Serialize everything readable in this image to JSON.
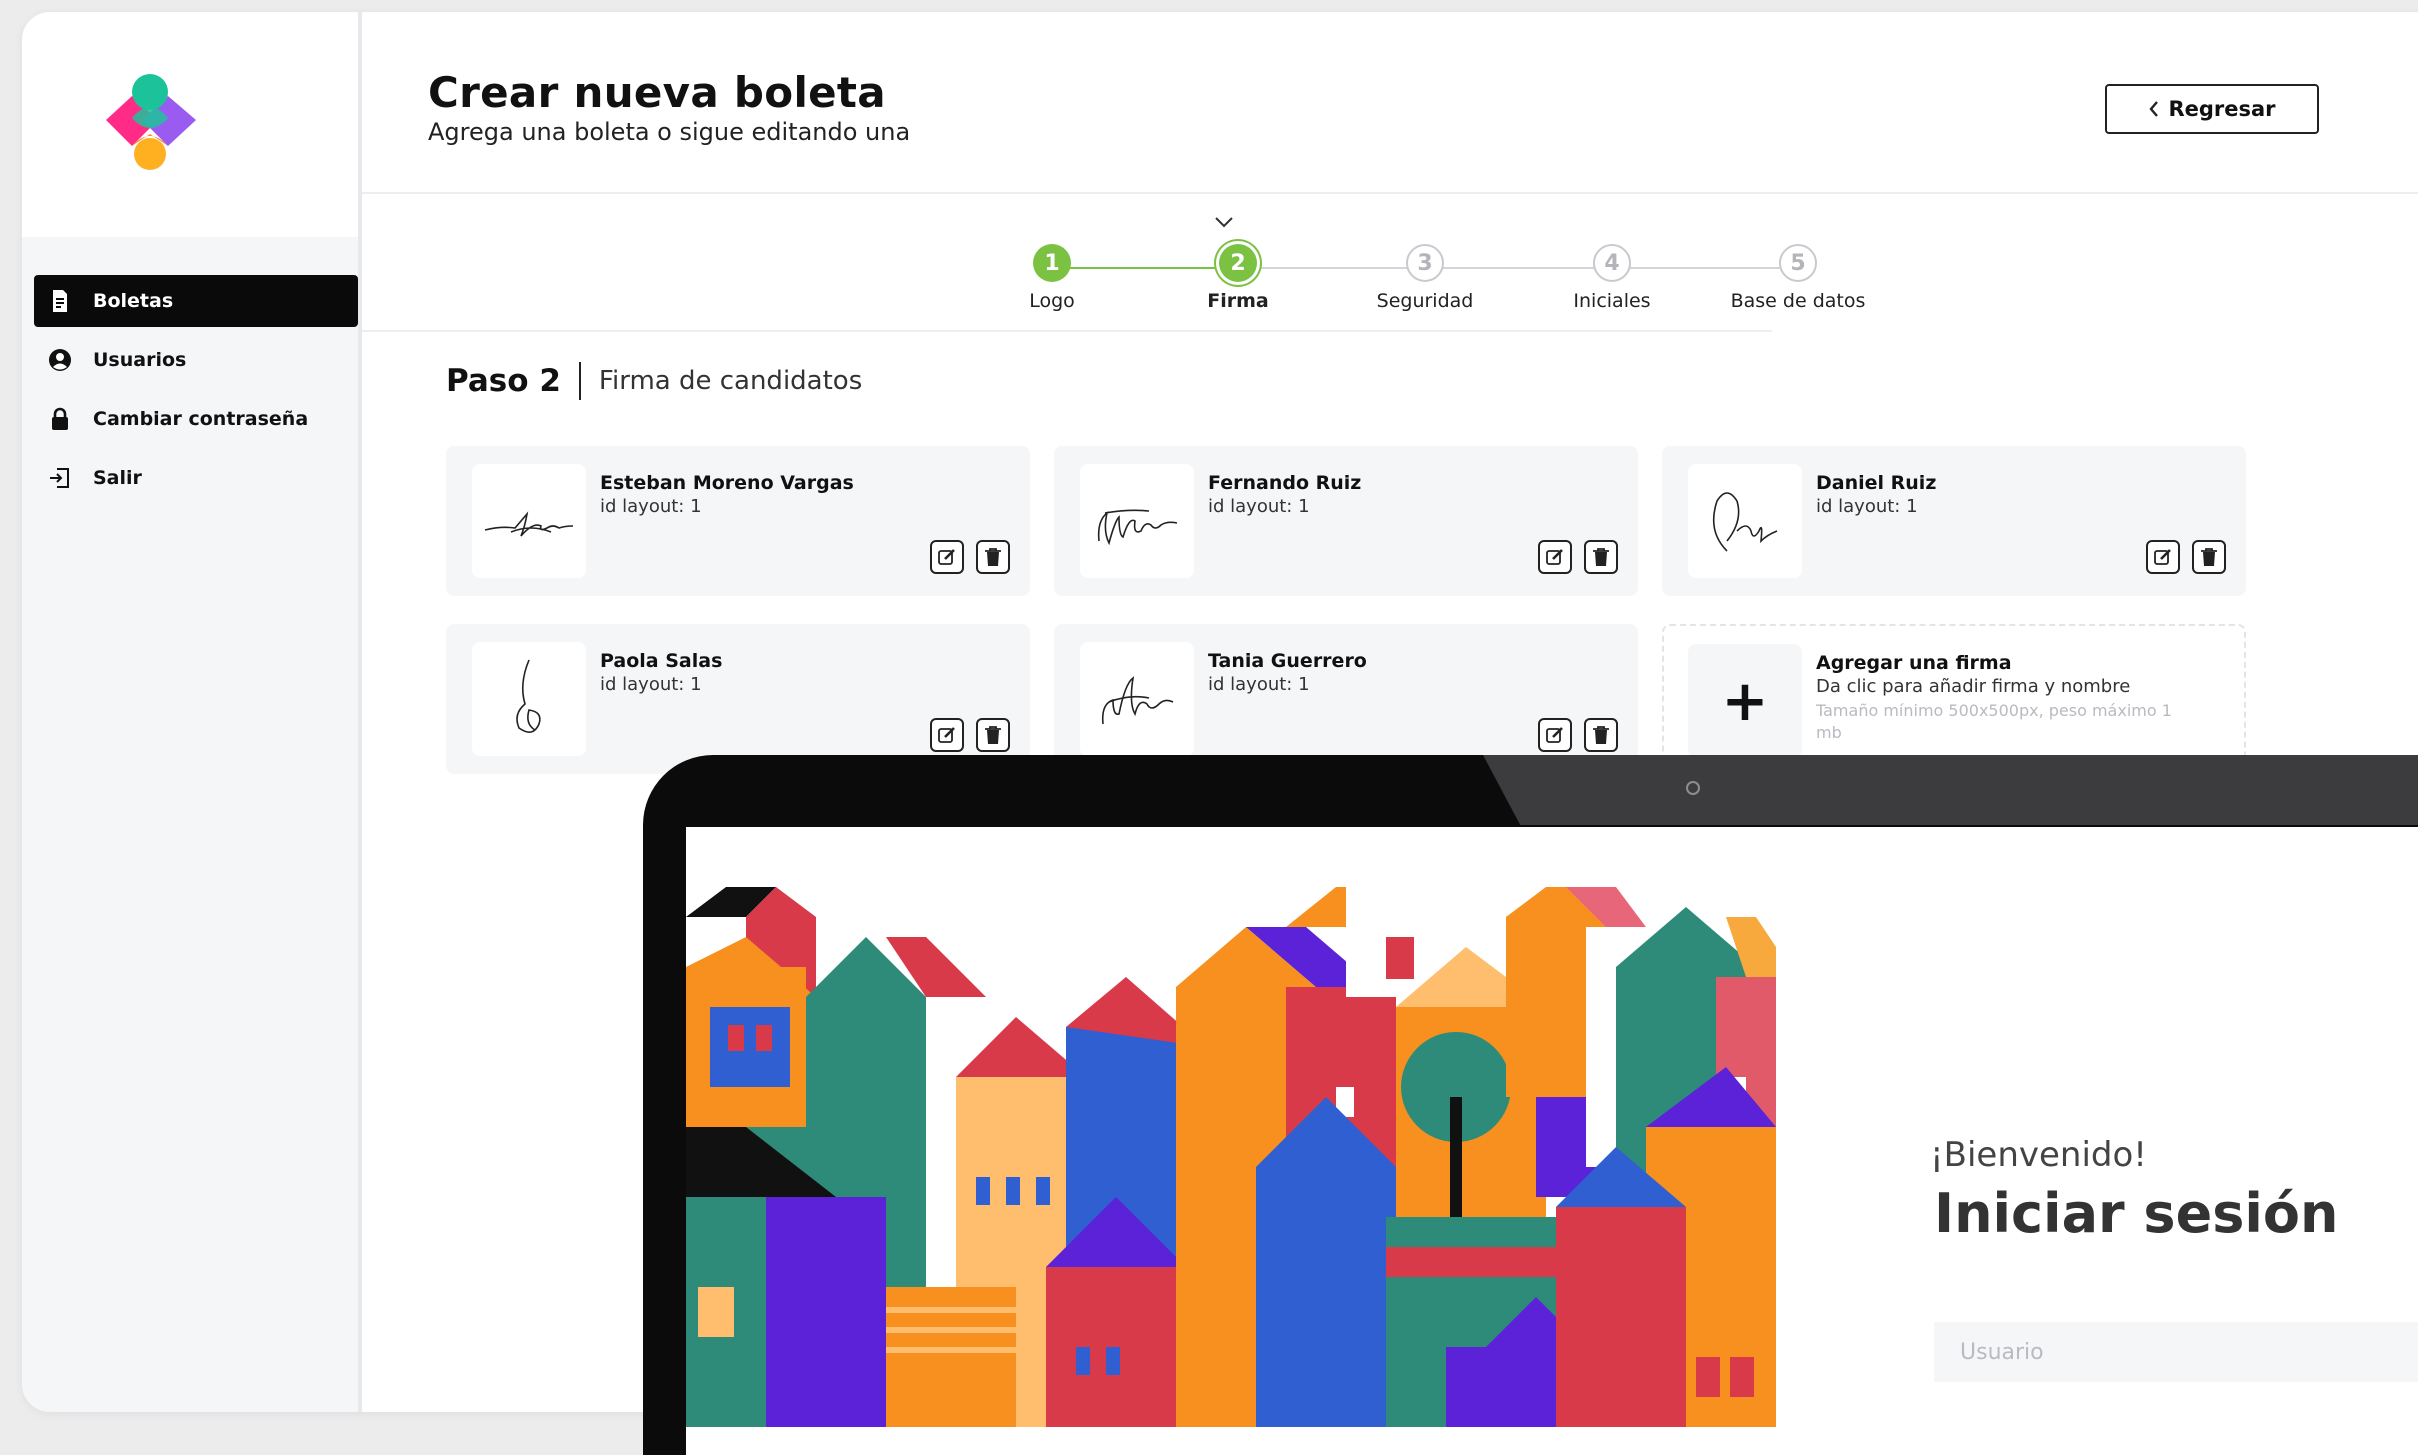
{
  "nav": {
    "items": [
      {
        "label": "Boletas",
        "active": true
      },
      {
        "label": "Usuarios"
      },
      {
        "label": "Cambiar contraseña"
      },
      {
        "label": "Salir"
      }
    ]
  },
  "header": {
    "title": "Crear nueva boleta",
    "subtitle": "Agrega una boleta o sigue editando una",
    "back_label": "Regresar"
  },
  "stepper": {
    "current": 2,
    "steps": [
      {
        "num": "1",
        "label": "Logo",
        "state": "done"
      },
      {
        "num": "2",
        "label": "Firma",
        "state": "current"
      },
      {
        "num": "3",
        "label": "Seguridad",
        "state": "todo"
      },
      {
        "num": "4",
        "label": "Iniciales",
        "state": "todo"
      },
      {
        "num": "5",
        "label": "Base de datos",
        "state": "todo"
      }
    ]
  },
  "step_header": {
    "num": "Paso 2",
    "text": "Firma de candidatos"
  },
  "cards": [
    {
      "name": "Esteban Moreno Vargas",
      "id_text": "id layout: 1"
    },
    {
      "name": "Fernando Ruiz",
      "id_text": "id layout: 1"
    },
    {
      "name": "Daniel Ruiz",
      "id_text": "id layout: 1"
    },
    {
      "name": "Paola Salas",
      "id_text": "id layout: 1"
    },
    {
      "name": "Tania Guerrero",
      "id_text": "id layout: 1"
    }
  ],
  "add_card": {
    "title": "Agregar una firma",
    "subtitle": "Da clic para añadir firma y nombre",
    "hint": "Tamaño mínimo 500x500px, peso máximo 1 mb",
    "plus": "+"
  },
  "login": {
    "welcome": "¡Bienvenido!",
    "title": "Iniciar sesión",
    "user_placeholder": "Usuario"
  },
  "colors": {
    "accent_green": "#7bc142",
    "dark": "#0a0a0a",
    "card_bg": "#f5f6f8"
  },
  "icons": [
    "logo-heart",
    "document-icon",
    "user-circle-icon",
    "lock-icon",
    "logout-icon",
    "chevron-left-icon",
    "chevron-down-icon",
    "edit-icon",
    "trash-icon",
    "plus-icon",
    "camera-icon"
  ]
}
